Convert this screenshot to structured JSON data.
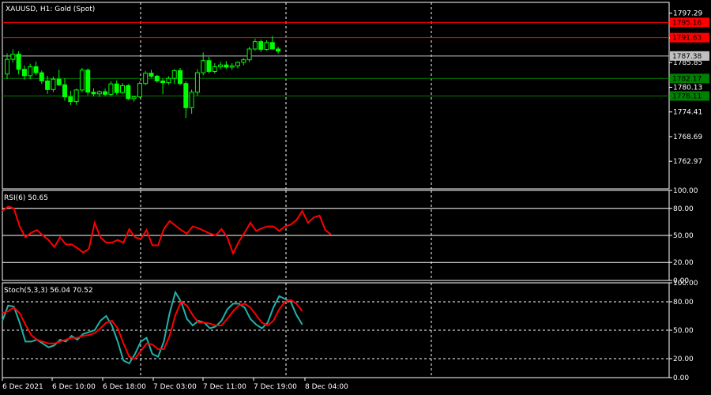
{
  "colors": {
    "background": "#000000",
    "frame": "#ffffff",
    "bull_candle": "#00ff00",
    "bear_candle": "#000000",
    "rsi_line": "#ff0000",
    "stoch_main": "#20b2aa",
    "stoch_signal": "#ff0000",
    "resistance_line": "#ff0000",
    "support_line": "#008000",
    "current_price_tag": "#c0c0c0"
  },
  "chart_data": [
    {
      "type": "candlestick",
      "title": "XAUUSD, H1:  Gold (Spot)",
      "ylim": [
        1756.6,
        1799.8
      ],
      "y_ticks": [
        "1797.29",
        "1791.57",
        "1785.85",
        "1780.13",
        "1774.41",
        "1768.69",
        "1762.97"
      ],
      "x_ticks": [
        "6 Dec 2021",
        "6 Dec 10:00",
        "6 Dec 18:00",
        "7 Dec 03:00",
        "7 Dec 11:00",
        "7 Dec 19:00",
        "8 Dec 04:00"
      ],
      "candles": [
        {
          "o": 1783.2,
          "h": 1788.0,
          "l": 1782.1,
          "c": 1786.6
        },
        {
          "o": 1786.6,
          "h": 1788.9,
          "l": 1785.9,
          "c": 1787.8
        },
        {
          "o": 1787.8,
          "h": 1788.5,
          "l": 1783.1,
          "c": 1784.3
        },
        {
          "o": 1784.3,
          "h": 1785.2,
          "l": 1781.9,
          "c": 1782.8
        },
        {
          "o": 1782.8,
          "h": 1785.6,
          "l": 1782.0,
          "c": 1784.9
        },
        {
          "o": 1784.9,
          "h": 1786.1,
          "l": 1782.9,
          "c": 1783.5
        },
        {
          "o": 1783.5,
          "h": 1784.0,
          "l": 1780.9,
          "c": 1781.6
        },
        {
          "o": 1781.6,
          "h": 1782.8,
          "l": 1778.6,
          "c": 1779.6
        },
        {
          "o": 1779.6,
          "h": 1782.6,
          "l": 1779.0,
          "c": 1782.0
        },
        {
          "o": 1782.0,
          "h": 1784.2,
          "l": 1780.4,
          "c": 1780.7
        },
        {
          "o": 1780.7,
          "h": 1782.2,
          "l": 1777.0,
          "c": 1777.9
        },
        {
          "o": 1777.9,
          "h": 1779.3,
          "l": 1776.0,
          "c": 1776.8
        },
        {
          "o": 1776.8,
          "h": 1779.8,
          "l": 1776.1,
          "c": 1779.5
        },
        {
          "o": 1779.5,
          "h": 1784.6,
          "l": 1779.0,
          "c": 1784.1
        },
        {
          "o": 1784.1,
          "h": 1784.5,
          "l": 1778.3,
          "c": 1779.0
        },
        {
          "o": 1779.0,
          "h": 1779.9,
          "l": 1778.0,
          "c": 1778.6
        },
        {
          "o": 1778.6,
          "h": 1779.4,
          "l": 1777.9,
          "c": 1779.1
        },
        {
          "o": 1779.1,
          "h": 1779.8,
          "l": 1778.1,
          "c": 1778.5
        },
        {
          "o": 1778.5,
          "h": 1781.5,
          "l": 1778.0,
          "c": 1780.9
        },
        {
          "o": 1780.9,
          "h": 1781.7,
          "l": 1778.4,
          "c": 1778.9
        },
        {
          "o": 1778.9,
          "h": 1781.1,
          "l": 1778.5,
          "c": 1780.5
        },
        {
          "o": 1780.5,
          "h": 1780.9,
          "l": 1777.2,
          "c": 1777.5
        },
        {
          "o": 1777.5,
          "h": 1778.1,
          "l": 1776.8,
          "c": 1777.9
        },
        {
          "o": 1777.9,
          "h": 1781.5,
          "l": 1777.7,
          "c": 1781.0
        },
        {
          "o": 1781.0,
          "h": 1783.9,
          "l": 1780.6,
          "c": 1783.4
        },
        {
          "o": 1783.4,
          "h": 1784.2,
          "l": 1782.3,
          "c": 1782.7
        },
        {
          "o": 1782.7,
          "h": 1783.0,
          "l": 1781.2,
          "c": 1781.6
        },
        {
          "o": 1781.6,
          "h": 1782.1,
          "l": 1778.5,
          "c": 1781.2
        },
        {
          "o": 1781.2,
          "h": 1782.7,
          "l": 1780.7,
          "c": 1782.2
        },
        {
          "o": 1782.2,
          "h": 1784.3,
          "l": 1780.9,
          "c": 1784.0
        },
        {
          "o": 1784.0,
          "h": 1784.6,
          "l": 1780.6,
          "c": 1781.0
        },
        {
          "o": 1781.0,
          "h": 1781.5,
          "l": 1773.0,
          "c": 1775.4
        },
        {
          "o": 1775.4,
          "h": 1779.6,
          "l": 1774.0,
          "c": 1779.0
        },
        {
          "o": 1779.0,
          "h": 1784.3,
          "l": 1778.2,
          "c": 1783.5
        },
        {
          "o": 1783.5,
          "h": 1788.2,
          "l": 1782.9,
          "c": 1786.3
        },
        {
          "o": 1786.3,
          "h": 1787.2,
          "l": 1783.3,
          "c": 1783.8
        },
        {
          "o": 1783.8,
          "h": 1785.7,
          "l": 1783.3,
          "c": 1784.9
        },
        {
          "o": 1784.9,
          "h": 1786.0,
          "l": 1784.3,
          "c": 1785.3
        },
        {
          "o": 1785.3,
          "h": 1786.2,
          "l": 1784.4,
          "c": 1784.8
        },
        {
          "o": 1784.8,
          "h": 1785.7,
          "l": 1784.2,
          "c": 1785.1
        },
        {
          "o": 1785.1,
          "h": 1786.1,
          "l": 1784.5,
          "c": 1785.9
        },
        {
          "o": 1785.9,
          "h": 1786.9,
          "l": 1785.2,
          "c": 1786.5
        },
        {
          "o": 1786.5,
          "h": 1789.5,
          "l": 1786.0,
          "c": 1789.0
        },
        {
          "o": 1789.0,
          "h": 1791.4,
          "l": 1788.6,
          "c": 1790.7
        },
        {
          "o": 1790.7,
          "h": 1791.2,
          "l": 1788.3,
          "c": 1788.9
        },
        {
          "o": 1788.9,
          "h": 1791.0,
          "l": 1788.6,
          "c": 1790.5
        },
        {
          "o": 1790.5,
          "h": 1792.0,
          "l": 1788.9,
          "c": 1789.0
        },
        {
          "o": 1789.0,
          "h": 1789.5,
          "l": 1787.9,
          "c": 1788.5
        }
      ],
      "levels": [
        {
          "value": 1795.16,
          "label": "1795.16",
          "kind": "resistance"
        },
        {
          "value": 1791.63,
          "label": "1791.63",
          "kind": "resistance"
        },
        {
          "value": 1787.38,
          "label": "1787.38",
          "kind": "current"
        },
        {
          "value": 1782.17,
          "label": "1782.17",
          "kind": "support"
        },
        {
          "value": 1778.11,
          "label": "1778.11",
          "kind": "support"
        }
      ]
    },
    {
      "type": "line",
      "title": "RSI(6) 50.65",
      "ylim": [
        0,
        100
      ],
      "y_ticks": [
        "100.00",
        "80.00",
        "50.00",
        "20.00",
        "0.00"
      ],
      "levels": [
        80,
        50,
        20
      ],
      "series": [
        {
          "values": [
            77,
            82,
            80,
            60,
            48,
            53,
            56,
            50,
            45,
            37,
            48,
            40,
            40,
            36,
            31,
            35,
            64,
            48,
            42,
            42,
            45,
            42,
            57,
            48,
            46,
            56,
            39,
            39,
            57,
            66,
            61,
            56,
            52,
            60,
            58,
            55,
            52,
            50,
            57,
            48,
            30,
            43,
            53,
            64,
            55,
            58,
            60,
            60,
            55,
            60,
            62,
            67,
            77,
            64,
            70,
            72,
            56,
            51
          ]
        }
      ]
    },
    {
      "type": "line",
      "title": "Stoch(5,3,3) 56.04 70.52",
      "ylim": [
        0,
        100
      ],
      "y_ticks": [
        "100.00",
        "80.00",
        "50.00",
        "20.00",
        "0.00"
      ],
      "levels": [
        80,
        50,
        20
      ],
      "series": [
        {
          "values": [
            60,
            76,
            75,
            58,
            38,
            38,
            40,
            36,
            32,
            34,
            40,
            38,
            44,
            40,
            46,
            48,
            50,
            60,
            65,
            55,
            38,
            18,
            15,
            25,
            38,
            42,
            25,
            22,
            38,
            68,
            90,
            80,
            62,
            55,
            60,
            58,
            52,
            54,
            60,
            72,
            78,
            78,
            74,
            62,
            56,
            52,
            58,
            74,
            86,
            83,
            80,
            66,
            56
          ]
        },
        {
          "values": [
            68,
            70,
            74,
            68,
            56,
            45,
            40,
            38,
            36,
            36,
            38,
            40,
            42,
            42,
            44,
            45,
            47,
            52,
            58,
            60,
            52,
            36,
            22,
            20,
            28,
            36,
            35,
            30,
            30,
            44,
            66,
            80,
            76,
            66,
            58,
            58,
            57,
            55,
            55,
            62,
            70,
            76,
            78,
            74,
            66,
            58,
            55,
            60,
            72,
            80,
            82,
            78,
            70
          ]
        }
      ]
    }
  ]
}
